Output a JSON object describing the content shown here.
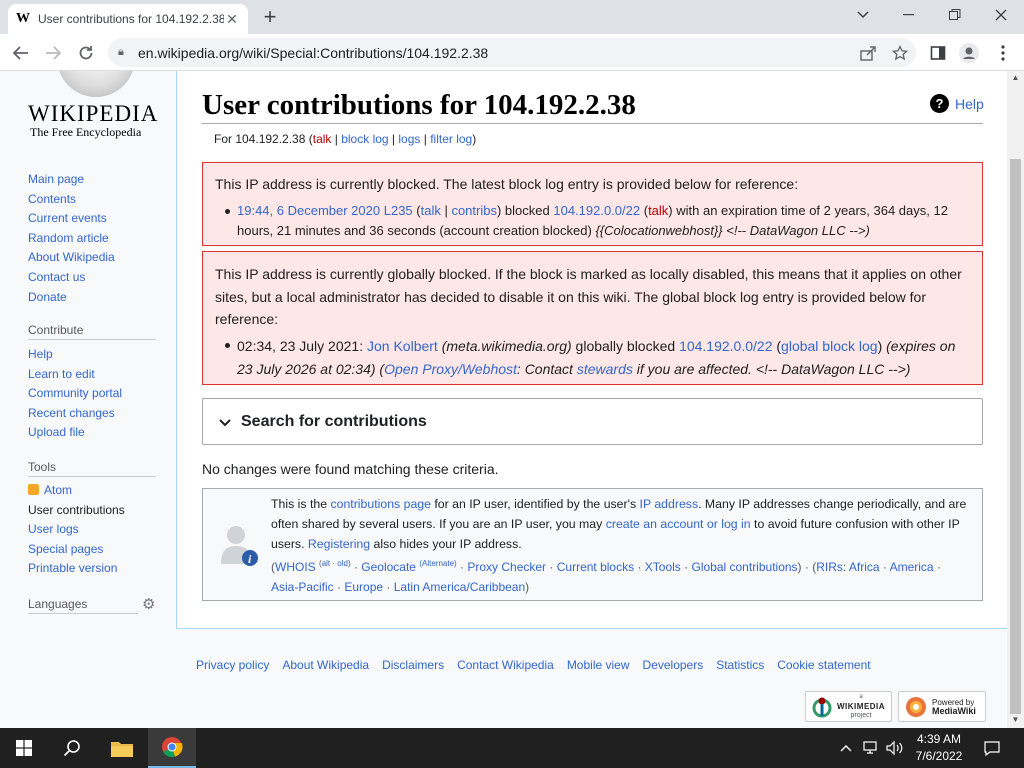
{
  "browser": {
    "tab_title": "User contributions for 104.192.2.38 - Wikipedia",
    "tab_favicon": "W",
    "new_tab": "+",
    "url": "en.wikipedia.org/wiki/Special:Contributions/104.192.2.38"
  },
  "logo": {
    "wordmark": "WIKIPEDIA",
    "tagline": "The Free Encyclopedia",
    "globe_glyph": "维 Ω"
  },
  "sidebar": {
    "nav": [
      "Main page",
      "Contents",
      "Current events",
      "Random article",
      "About Wikipedia",
      "Contact us",
      "Donate"
    ],
    "contribute_heading": "Contribute",
    "contribute": [
      "Help",
      "Learn to edit",
      "Community portal",
      "Recent changes",
      "Upload file"
    ],
    "tools_heading": "Tools",
    "tools": [
      "Atom",
      "User contributions",
      "User logs",
      "Special pages",
      "Printable version"
    ],
    "languages_heading": "Languages"
  },
  "content": {
    "title": "User contributions for 104.192.2.38",
    "help": "Help",
    "sub": {
      "prefix": "For 104.192.2.38 (",
      "talk": "talk",
      "sep1": " | ",
      "block_log": "block log",
      "sep2": " | ",
      "logs": "logs",
      "sep3": " | ",
      "filter_log": "filter log",
      "suffix": ")"
    },
    "block_notice": {
      "intro": "This IP address is currently blocked. The latest block log entry is provided below for reference:",
      "time": "19:44, 6 December 2020",
      "admin": "L235",
      "open": " (",
      "talk": "talk",
      "pipe": " | ",
      "contribs": "contribs",
      "close_blocked": ") blocked ",
      "target": "104.192.0.0/22",
      "open2": " (",
      "target_talk": "talk",
      "rest1": ") with an expiration time of 2 years, 364 days, 12 hours, 21 minutes and 36 seconds (account creation blocked) ",
      "reason": "{{Colocationwebhost}} <!-- DataWagon LLC -->)"
    },
    "global_notice": {
      "intro": "This IP address is currently globally blocked. If the block is marked as locally disabled, this means that it applies on other sites, but a local administrator has decided to disable it on this wiki. The global block log entry is provided below for reference:",
      "time": "02:34, 23 July 2021: ",
      "admin": "Jon Kolbert",
      "meta": " (meta.wikimedia.org)",
      "blocked": " globally blocked ",
      "target": "104.192.0.0/22",
      "open": " (",
      "gbl": "global block log",
      "close": ")",
      "expires": " (expires on 23 July 2026 at 02:34)",
      "open2": " (",
      "proxy": "Open Proxy/Webhost",
      "contact": ": Contact ",
      "stewards": "stewards",
      "tail": " if you are affected. <!-- DataWagon LLC -->)"
    },
    "search_label": "Search for contributions",
    "no_changes": "No changes were found matching these criteria.",
    "info": {
      "t1": "This is the ",
      "contrib_page": "contributions page",
      "t2": " for an IP user, identified by the user's ",
      "ip_address": "IP address",
      "t3": ". Many IP addresses change periodically, and are often shared by several users. If you are an IP user, you may ",
      "create": "create an account or log in",
      "t4": " to avoid future confusion with other IP users. ",
      "registering": "Registering",
      "t5": " also hides your IP address.",
      "open": "(",
      "whois": "WHOIS",
      "alt": "alt",
      "old": "old",
      "geolocate": "Geolocate",
      "alternate": "(Alternate)",
      "proxy_checker": "Proxy Checker",
      "current_blocks": "Current blocks",
      "xtools": "XTools",
      "global_contribs": "Global contributions",
      "close_rirs": ") · (",
      "rirs": "RIRs",
      "africa": "Africa",
      "america": "America",
      "asia": "Asia-Pacific",
      "europe": "Europe",
      "latam": "Latin America/Caribbean",
      "close": ")"
    }
  },
  "footer": {
    "links": [
      "Privacy policy",
      "About Wikipedia",
      "Disclaimers",
      "Contact Wikipedia",
      "Mobile view",
      "Developers",
      "Statistics",
      "Cookie statement"
    ],
    "wikimedia_badge_small": "a",
    "wikimedia_badge": "WIKIMEDIA",
    "wikimedia_badge_sub": "project",
    "mediawiki_badge_top": "Powered by",
    "mediawiki_badge": "MediaWiki"
  },
  "taskbar": {
    "time": "4:39 AM",
    "date": "7/6/2022"
  },
  "colors": {
    "link": "#3366cc",
    "redlink": "#ba0000",
    "error_bg": "#fee7e6",
    "error_border": "#dd3333",
    "taskbar": "#202020"
  }
}
